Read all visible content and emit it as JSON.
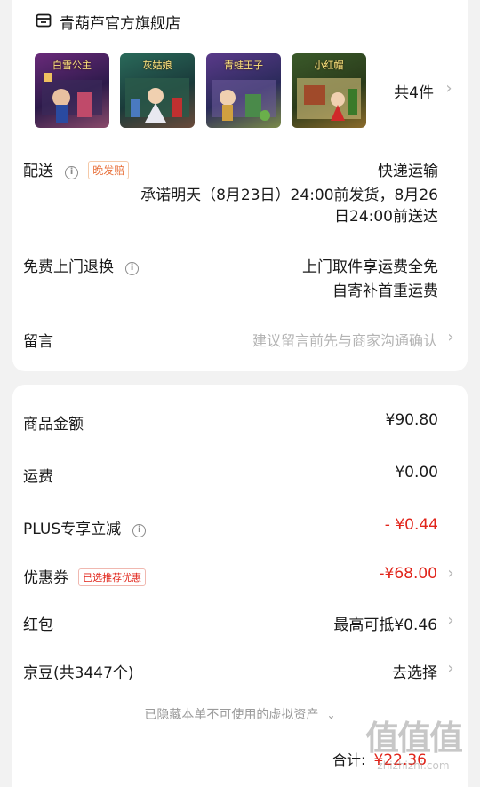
{
  "store": {
    "name": "青葫芦官方旗舰店",
    "icon": "store-icon"
  },
  "products": [
    {
      "title": "白雪公主",
      "color": "#5b2d6e"
    },
    {
      "title": "灰姑娘",
      "color": "#1f5a4a"
    },
    {
      "title": "青蛙王子",
      "color": "#4a3a7a"
    },
    {
      "title": "小红帽",
      "color": "#6b3a20"
    }
  ],
  "product_count": "共4件",
  "delivery": {
    "label": "配送",
    "badge": "晚发赔",
    "method": "快递运输",
    "promise_line1": "承诺明天（8月23日）24:00前发货，8月26",
    "promise_line2": "日24:00前送达"
  },
  "return": {
    "label": "免费上门退换",
    "line1": "上门取件享运费全免",
    "line2": "自寄补首重运费"
  },
  "note": {
    "label": "留言",
    "placeholder": "建议留言前先与商家沟通确认"
  },
  "summary": {
    "goods_amount_label": "商品金额",
    "goods_amount": "¥90.80",
    "shipping_label": "运费",
    "shipping": "¥0.00",
    "plus_label": "PLUS专享立减",
    "plus": "- ¥0.44",
    "coupon_label": "优惠券",
    "coupon_badge": "已选推荐优惠",
    "coupon": "-¥68.00",
    "redpacket_label": "红包",
    "redpacket": "最高可抵¥0.46",
    "jingdou_label": "京豆(共3447个)",
    "jingdou": "去选择",
    "hidden_assets": "已隐藏本单不可使用的虚拟资产",
    "total_label": "合计:",
    "total": "¥22.36"
  },
  "watermark": {
    "text": "值值值",
    "url": "zhizhizhi.com"
  },
  "colors": {
    "accent_red": "#e1251b",
    "badge_orange": "#e8703a",
    "background": "#f2f2f2",
    "card": "#ffffff"
  }
}
